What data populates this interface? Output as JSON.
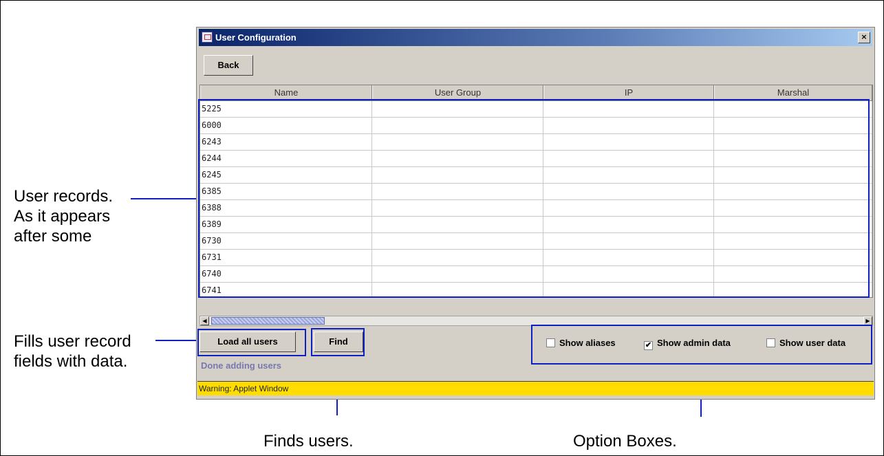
{
  "window": {
    "title": "User Configuration",
    "close_label": "×"
  },
  "toolbar": {
    "back_label": "Back"
  },
  "table": {
    "columns": [
      "Name",
      "User Group",
      "IP",
      "Marshal"
    ],
    "rows": [
      "5225",
      "6000",
      "6243",
      "6244",
      "6245",
      "6385",
      "6388",
      "6389",
      "6730",
      "6731",
      "6740",
      "6741"
    ]
  },
  "scroll": {
    "left_arrow": "◀",
    "right_arrow": "▶"
  },
  "actions": {
    "load_all_label": "Load all users",
    "find_label": "Find"
  },
  "options": [
    {
      "label": "Show aliases",
      "checked": false
    },
    {
      "label": "Show admin data",
      "checked": true
    },
    {
      "label": "Show user data",
      "checked": false
    }
  ],
  "status": {
    "text": "Done adding users"
  },
  "warning": {
    "text": "Warning: Applet Window"
  },
  "annotations": {
    "user_records": [
      "User records.",
      "As it appears",
      "after some"
    ],
    "fills": [
      "Fills user record",
      "fields with data."
    ],
    "finds": "Finds users.",
    "options": "Option Boxes."
  },
  "colors": {
    "annotation_blue": "#1020c0",
    "warning_yellow": "#ffdd00",
    "title_blue": "#0a246a"
  }
}
